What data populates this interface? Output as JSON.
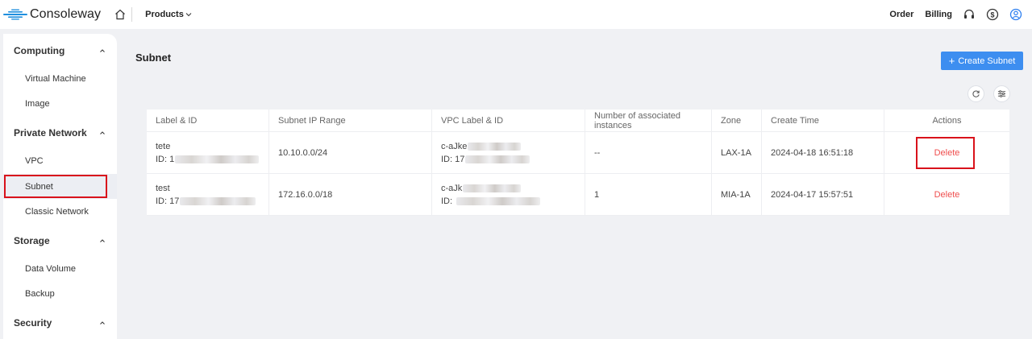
{
  "header": {
    "brand": "Consoleway",
    "products_label": "Products",
    "order_label": "Order",
    "billing_label": "Billing",
    "colors": {
      "accent": "#3d8ef0",
      "brand_blue": "#1f8fde",
      "highlight_red": "#d9121b"
    }
  },
  "sidebar": {
    "groups": [
      {
        "title": "Computing",
        "items": [
          "Virtual Machine",
          "Image"
        ]
      },
      {
        "title": "Private Network",
        "items": [
          "VPC",
          "Subnet",
          "Classic Network"
        ]
      },
      {
        "title": "Storage",
        "items": [
          "Data Volume",
          "Backup"
        ]
      },
      {
        "title": "Security",
        "items": []
      }
    ],
    "active_item": "Subnet"
  },
  "main": {
    "title": "Subnet",
    "create_button": "Create Subnet",
    "columns": [
      "Label & ID",
      "Subnet IP Range",
      "VPC Label & ID",
      "Number of associated instances",
      "Zone",
      "Create Time",
      "Actions"
    ],
    "rows": [
      {
        "label": "tete",
        "id_prefix": "ID: 1",
        "ip_range": "10.10.0.0/24",
        "vpc_label": "c-aJke",
        "vpc_id_prefix": "ID: 17",
        "instances": "--",
        "zone": "LAX-1A",
        "created": "2024-04-18 16:51:18",
        "action": "Delete"
      },
      {
        "label": "test",
        "id_prefix": "ID: 17",
        "ip_range": "172.16.0.0/18",
        "vpc_label": "c-aJk",
        "vpc_id_prefix": "ID:",
        "instances": "1",
        "zone": "MIA-1A",
        "created": "2024-04-17 15:57:51",
        "action": "Delete"
      }
    ]
  }
}
